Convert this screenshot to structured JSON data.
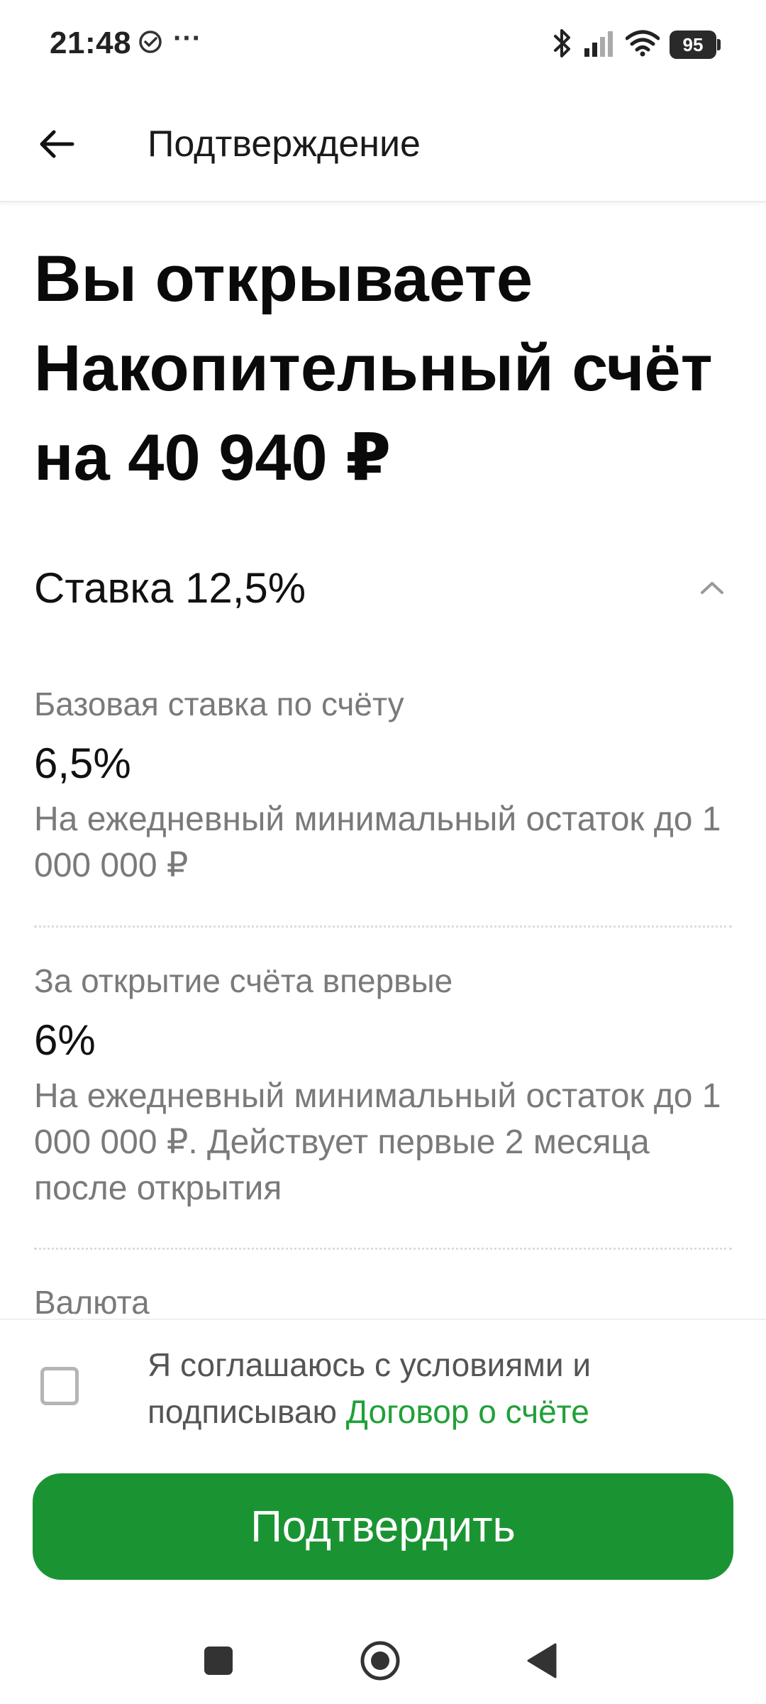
{
  "status_bar": {
    "time": "21:48",
    "dots": "···",
    "battery": "95"
  },
  "header": {
    "title": "Подтверждение"
  },
  "main": {
    "title": "Вы открываете Накопительный счёт на 40 940 ₽",
    "rate_title": "Ставка 12,5%",
    "rates": [
      {
        "label": "Базовая ставка по счёту",
        "value": "6,5%",
        "description": "На ежедневный минимальный остаток до 1 000 000 ₽"
      },
      {
        "label": "За открытие счёта впервые",
        "value": "6%",
        "description": "На ежедневный минимальный остаток до 1 000 000 ₽. Действует первые 2 месяца после открытия"
      }
    ],
    "currency_label": "Валюта"
  },
  "bottom": {
    "agree_prefix": "Я соглашаюсь с условиями и подписываю ",
    "agree_link": "Договор о счёте",
    "confirm_label": "Подтвердить"
  },
  "colors": {
    "accent_green": "#1a9432",
    "link_green": "#21a038",
    "secondary_text": "#7a7a7a"
  }
}
